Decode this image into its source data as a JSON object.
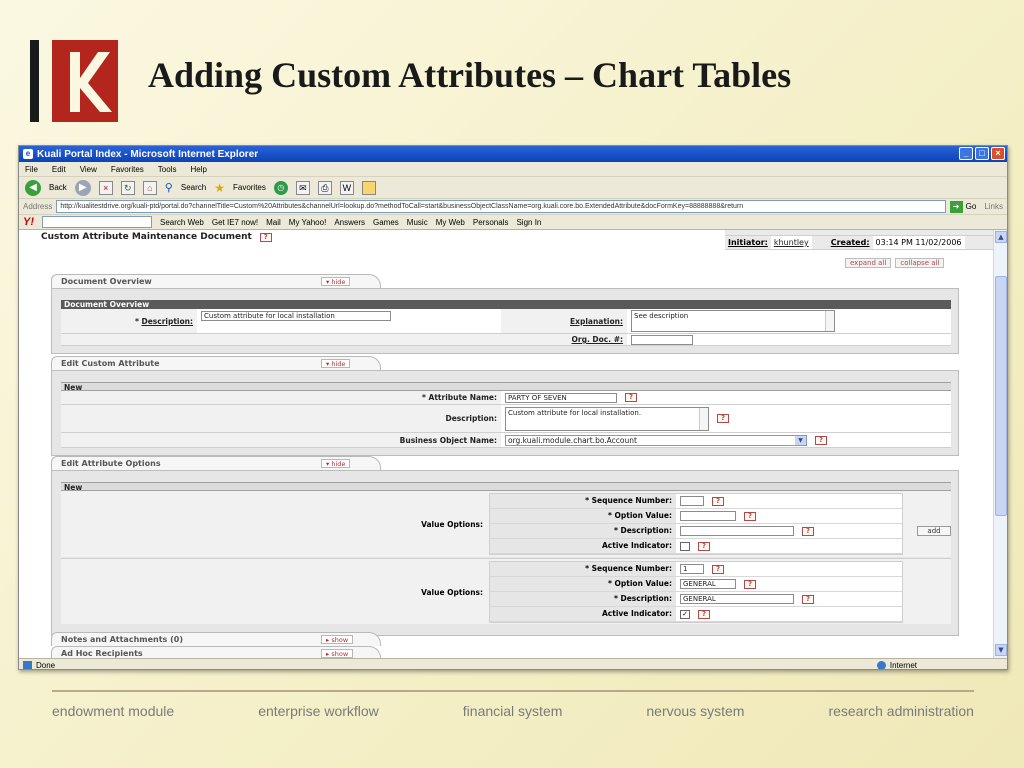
{
  "slide": {
    "title": "Adding Custom Attributes – Chart Tables",
    "footer": [
      "endowment module",
      "enterprise workflow",
      "financial system",
      "nervous system",
      "research administration"
    ],
    "colors": {
      "logo_red": "#b3261e",
      "logo_black": "#1a1a1a",
      "title": "#1a1a1a",
      "footer_text": "#7a7a7a"
    }
  },
  "browser": {
    "title": "Kuali Portal Index - Microsoft Internet Explorer",
    "menu": [
      "File",
      "Edit",
      "View",
      "Favorites",
      "Tools",
      "Help"
    ],
    "toolbar": {
      "back": "Back",
      "search": "Search",
      "favorites": "Favorites"
    },
    "address_label": "Address",
    "address_url": "http://kualitestdrive.org/kuali-ptd/portal.do?channelTitle=Custom%20Attributes&channelUrl=lookup.do?methodToCall=start&businessObjectClassName=org.kuali.core.bo.ExtendedAttribute&docFormKey=88888888&return",
    "go": "Go",
    "links": "Links",
    "yahoo": {
      "logo": "Y!",
      "search_web": "Search Web",
      "items": [
        "Get IE7 now!",
        "Mail",
        "My Yahoo!",
        "Answers",
        "Games",
        "Music",
        "My Web",
        "Personals",
        "Sign In"
      ]
    },
    "status_left": "Done",
    "status_zone": "Internet"
  },
  "document": {
    "title": "Custom Attribute Maintenance Document",
    "initiator_label": "Initiator:",
    "initiator": "khuntley",
    "created_label": "Created:",
    "created": "03:14 PM 11/02/2006",
    "expand_all": "expand all",
    "collapse_all": "collapse all",
    "tabs": {
      "overview": {
        "label": "Document Overview",
        "toggle": "hide"
      },
      "edit_attr": {
        "label": "Edit Custom Attribute",
        "toggle": "hide"
      },
      "options": {
        "label": "Edit Attribute Options",
        "toggle": "hide"
      },
      "notes": {
        "label": "Notes and Attachments (0)",
        "toggle": "show"
      },
      "adhoc": {
        "label": "Ad Hoc Recipients",
        "toggle": "show"
      }
    },
    "overview": {
      "subhead": "Document Overview",
      "desc_label": "Description:",
      "desc_value": "Custom attribute for local installation",
      "expl_label": "Explanation:",
      "expl_value": "See description",
      "orgdoc_label": "Org. Doc. #:"
    },
    "edit_attr": {
      "subhead": "New",
      "name_label": "Attribute Name:",
      "name_value": "PARTY OF SEVEN",
      "desc_label": "Description:",
      "desc_value": "Custom attribute for local installation.",
      "bo_label": "Business Object Name:",
      "bo_value": "org.kuali.module.chart.bo.Account"
    },
    "options": {
      "subhead": "New",
      "value_options_label": "Value Options:",
      "seq_label": "Sequence Number:",
      "opt_label": "Option Value:",
      "desc_label": "Description:",
      "active_label": "Active Indicator:",
      "add": "add",
      "rows": [
        {
          "seq": "",
          "opt": "",
          "desc": "",
          "active": ""
        },
        {
          "seq": "1",
          "opt": "GENERAL",
          "desc": "GENERAL",
          "active": "✓"
        }
      ]
    }
  }
}
